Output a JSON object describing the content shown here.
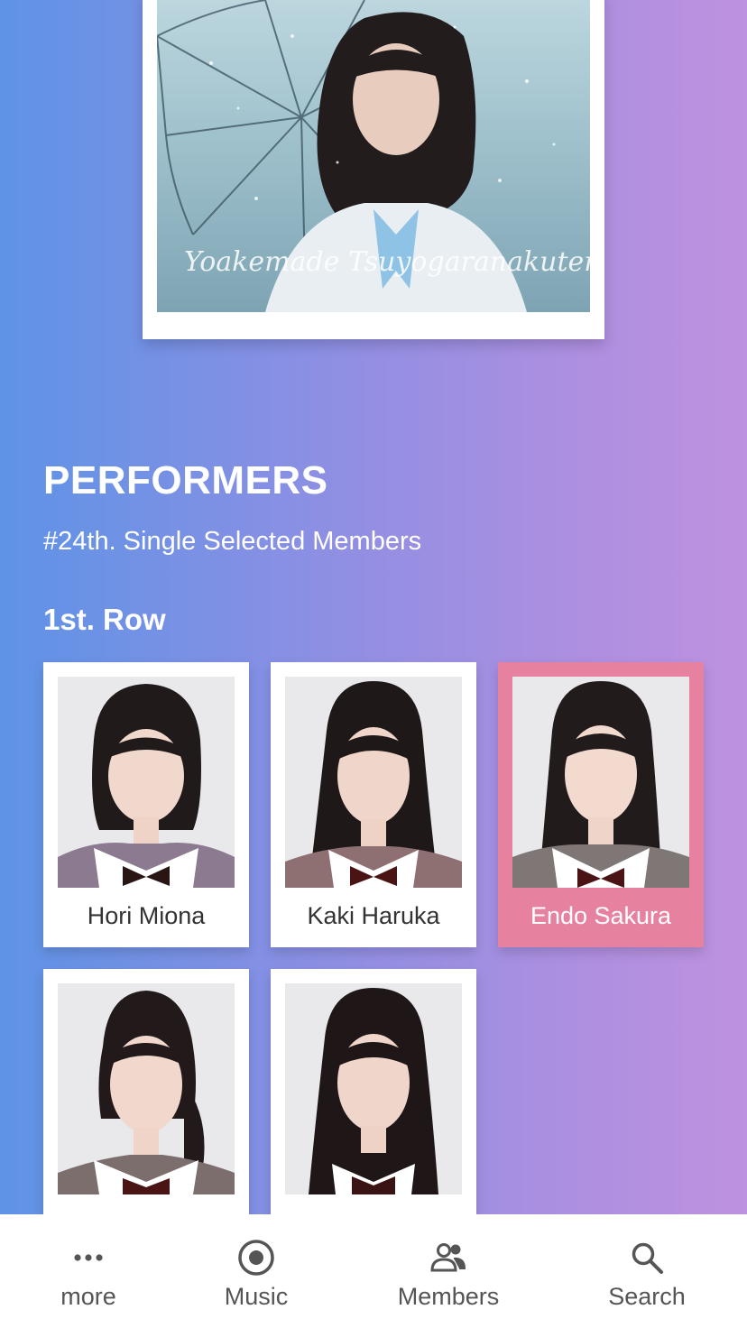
{
  "album": {
    "cover_script_text": "Yoakemade Tsuyogaranakutemoii"
  },
  "performers": {
    "title": "PERFORMERS",
    "subtitle": "#24th. Single Selected Members",
    "rows": [
      {
        "label": "1st. Row",
        "members": [
          {
            "name": "Hori Miona",
            "selected": false
          },
          {
            "name": "Kaki Haruka",
            "selected": false
          },
          {
            "name": "Endo Sakura",
            "selected": true
          }
        ]
      }
    ],
    "extra_members": [
      {
        "name": "",
        "selected": false
      },
      {
        "name": "",
        "selected": false
      }
    ]
  },
  "tabbar": {
    "items": [
      {
        "label": "more",
        "icon": "more-icon"
      },
      {
        "label": "Music",
        "icon": "music-disc-icon"
      },
      {
        "label": "Members",
        "icon": "members-icon"
      },
      {
        "label": "Search",
        "icon": "search-icon"
      }
    ]
  },
  "colors": {
    "selected_card": "#e6829f",
    "gradient_left": "#5e93e6",
    "gradient_right": "#bd92df"
  }
}
